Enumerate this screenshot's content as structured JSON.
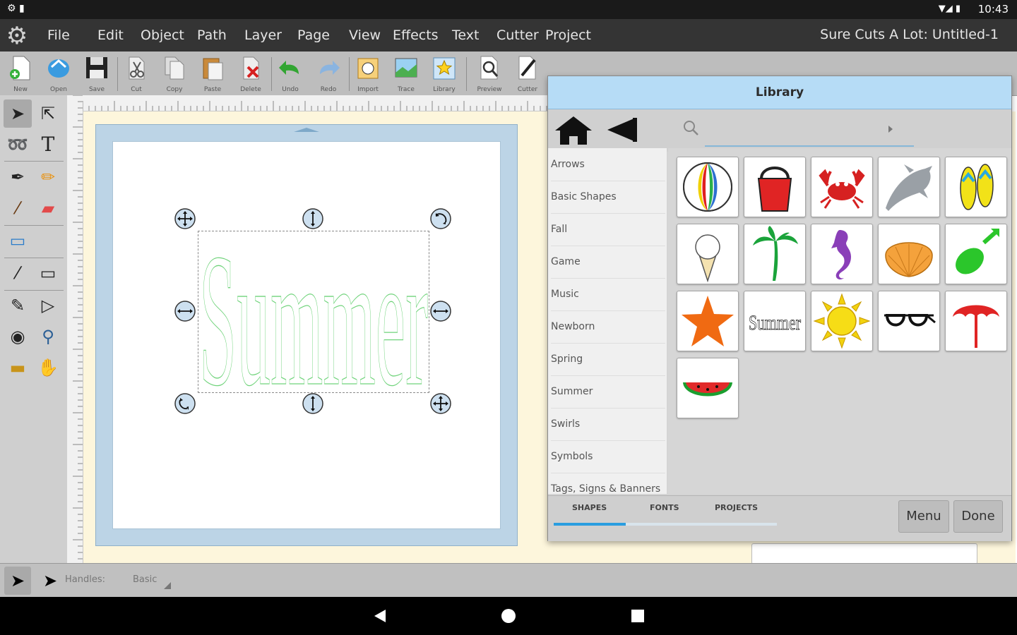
{
  "status": {
    "time": "10:43"
  },
  "menu": {
    "items": [
      "File",
      "Edit",
      "Object",
      "Path",
      "Layer",
      "Page",
      "View",
      "Effects",
      "Text",
      "Cutter",
      "Project"
    ],
    "app_title": "Sure Cuts A Lot: Untitled-1"
  },
  "toolbar": {
    "buttons": [
      "New",
      "Open",
      "Save",
      "Cut",
      "Copy",
      "Paste",
      "Delete",
      "Undo",
      "Redo",
      "Import",
      "Trace",
      "Library",
      "Preview",
      "Cutter"
    ]
  },
  "canvas": {
    "text": "Summer"
  },
  "library": {
    "title": "Library",
    "search_placeholder": "",
    "categories": [
      "Arrows",
      "Basic Shapes",
      "Fall",
      "Game",
      "Music",
      "Newborn",
      "Spring",
      "Summer",
      "Swirls",
      "Symbols",
      "Tags, Signs & Banners"
    ],
    "thumbnail_text": "Summer",
    "tabs": [
      "SHAPES",
      "FONTS",
      "PROJECTS"
    ],
    "menu_label": "Menu",
    "done_label": "Done"
  },
  "bottom": {
    "handles_label": "Handles:",
    "handles_value": "Basic"
  },
  "colors": {
    "library_header": "#b6dcf6",
    "accent": "#2a9de0",
    "summer_outline": "#6fd37a",
    "mat": "#bcd4e6",
    "workspace": "#fdf6dc"
  }
}
